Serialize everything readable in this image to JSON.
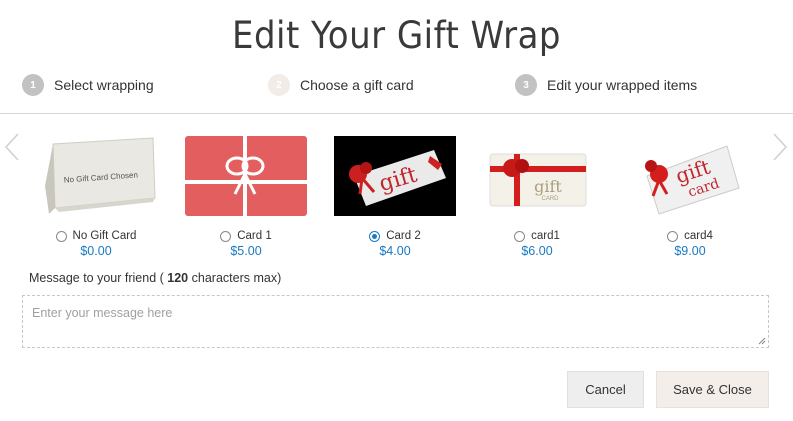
{
  "dialog": {
    "title": "Edit Your Gift Wrap"
  },
  "steps": [
    {
      "number": "1",
      "label": "Select wrapping",
      "state": "done",
      "color": "#c2c2c2"
    },
    {
      "number": "2",
      "label": "Choose a gift card",
      "state": "active",
      "color": "#f3ebe6"
    },
    {
      "number": "3",
      "label": "Edit your wrapped items",
      "state": "upcoming",
      "color": "#c2c2c2"
    }
  ],
  "carousel": {
    "prev_icon": "chevron-left-icon",
    "next_icon": "chevron-right-icon",
    "cards": [
      {
        "name": "No Gift Card",
        "price": "$0.00",
        "selected": false,
        "image_text": "No Gift Card Chosen"
      },
      {
        "name": "Card 1",
        "price": "$5.00",
        "selected": false
      },
      {
        "name": "Card 2",
        "price": "$4.00",
        "selected": true,
        "image_text": "gift"
      },
      {
        "name": "card1",
        "price": "$6.00",
        "selected": false,
        "image_text": "gift",
        "image_subtext": "CARD"
      },
      {
        "name": "card4",
        "price": "$9.00",
        "selected": false,
        "image_text": "gift",
        "image_subtext": "card"
      }
    ]
  },
  "message": {
    "label_prefix": "Message to your friend (",
    "max_chars": "120",
    "label_suffix": "characters max)",
    "placeholder": "Enter your message here"
  },
  "buttons": {
    "cancel": "Cancel",
    "save": "Save & Close"
  },
  "colors": {
    "accent": "#1979c3",
    "card1_bg": "#e35f5f"
  }
}
